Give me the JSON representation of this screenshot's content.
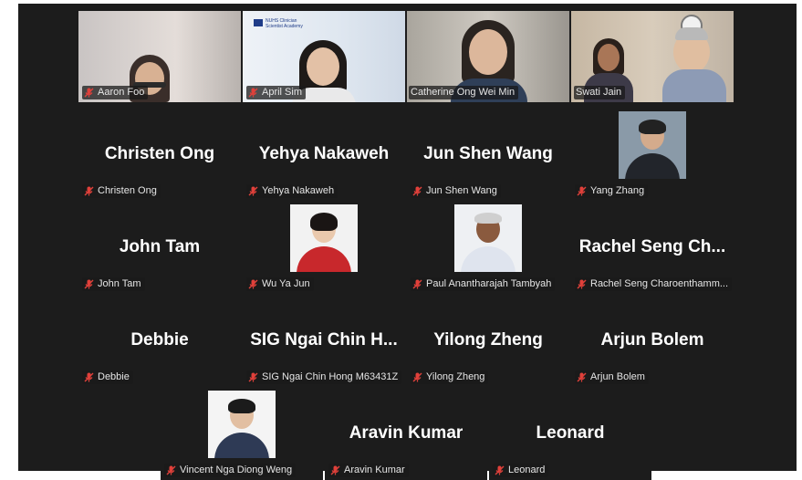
{
  "tiles_row1": [
    {
      "name": "Aaron Foo"
    },
    {
      "name": "April Sim",
      "logo_text_1": "NUHS Clinician",
      "logo_text_2": "Scientist Academy"
    },
    {
      "name": "Catherine Ong Wei Min"
    },
    {
      "name": "Swati Jain"
    }
  ],
  "tiles_row2": [
    {
      "display": "Christen Ong",
      "name": "Christen Ong"
    },
    {
      "display": "Yehya Nakaweh",
      "name": "Yehya Nakaweh"
    },
    {
      "display": "Jun Shen Wang",
      "name": "Jun Shen Wang"
    },
    {
      "name": "Yang Zhang"
    }
  ],
  "tiles_row3": [
    {
      "display": "John Tam",
      "name": "John Tam"
    },
    {
      "name": "Wu Ya Jun"
    },
    {
      "name": "Paul Anantharajah Tambyah"
    },
    {
      "display": "Rachel Seng Ch...",
      "name": "Rachel Seng Charoenthamm..."
    }
  ],
  "tiles_row4": [
    {
      "display": "Debbie",
      "name": "Debbie"
    },
    {
      "display": "SIG Ngai Chin H...",
      "name": "SIG Ngai Chin Hong M63431Z"
    },
    {
      "display": "Yilong Zheng",
      "name": "Yilong Zheng"
    },
    {
      "display": "Arjun Bolem",
      "name": "Arjun Bolem"
    }
  ],
  "tiles_row5": [
    {
      "name": "Vincent Nga Diong Weng"
    },
    {
      "display": "Aravin Kumar",
      "name": "Aravin Kumar"
    },
    {
      "display": "Leonard",
      "name": "Leonard"
    }
  ],
  "colors": {
    "background": "#1c1c1c",
    "active_speaker_border": "#2bd168",
    "muted_icon": "#e0403a"
  },
  "icons": {
    "muted": "microphone-muted-icon"
  }
}
